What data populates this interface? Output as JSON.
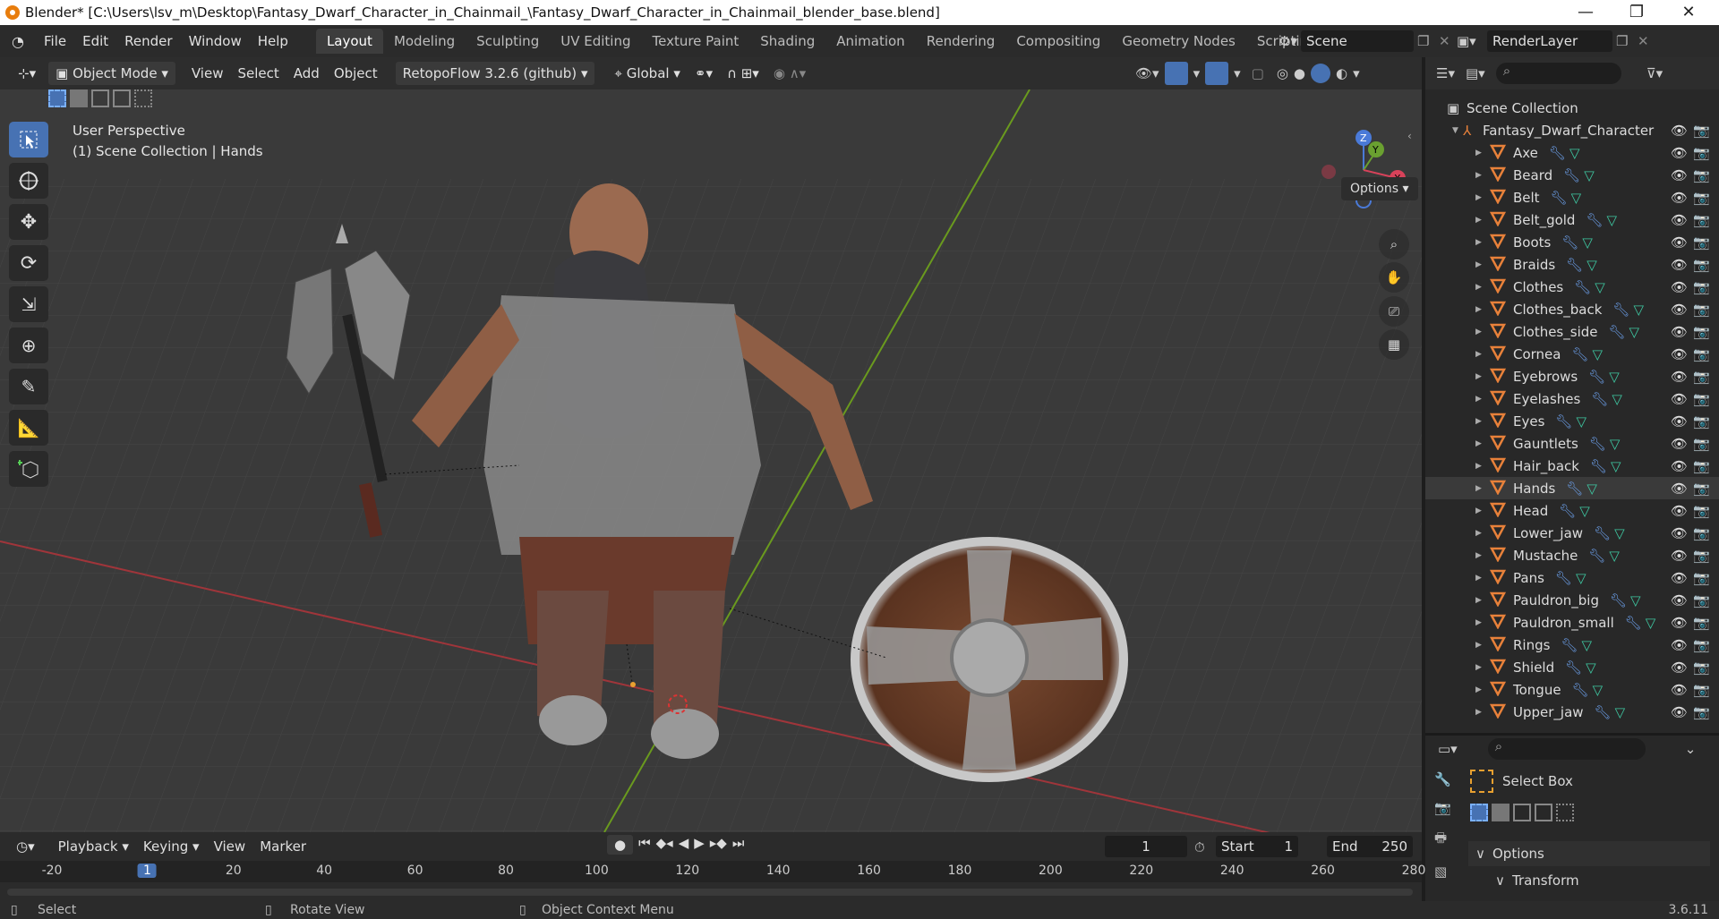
{
  "window": {
    "title": "Blender* [C:\\Users\\lsv_m\\Desktop\\Fantasy_Dwarf_Character_in_Chainmail_\\Fantasy_Dwarf_Character_in_Chainmail_blender_base.blend]",
    "minimize": "—",
    "maximize": "❐",
    "close": "✕"
  },
  "menu": [
    "File",
    "Edit",
    "Render",
    "Window",
    "Help"
  ],
  "workspaces": [
    "Layout",
    "Modeling",
    "Sculpting",
    "UV Editing",
    "Texture Paint",
    "Shading",
    "Animation",
    "Rendering",
    "Compositing",
    "Geometry Nodes",
    "Scripting",
    "+"
  ],
  "active_workspace": "Layout",
  "scene": {
    "name": "Scene",
    "render_layer": "RenderLayer"
  },
  "viewport_header": {
    "mode": "Object Mode",
    "menus": [
      "View",
      "Select",
      "Add",
      "Object"
    ],
    "addon": "RetopoFlow 3.2.6 (github)",
    "orientation": "Global",
    "options": "Options"
  },
  "viewport": {
    "perspective": "User Perspective",
    "context": "(1) Scene Collection | Hands",
    "gizmo": {
      "x": "X",
      "y": "Y",
      "z": "Z"
    }
  },
  "outliner": {
    "root": "Scene Collection",
    "collection": "Fantasy_Dwarf_Character",
    "items": [
      "Axe",
      "Beard",
      "Belt",
      "Belt_gold",
      "Boots",
      "Braids",
      "Clothes",
      "Clothes_back",
      "Clothes_side",
      "Cornea",
      "Eyebrows",
      "Eyelashes",
      "Eyes",
      "Gauntlets",
      "Hair_back",
      "Hands",
      "Head",
      "Lower_jaw",
      "Mustache",
      "Pans",
      "Pauldron_big",
      "Pauldron_small",
      "Rings",
      "Shield",
      "Tongue",
      "Upper_jaw"
    ],
    "selected": "Hands",
    "colors": {
      "mesh": "#e8813a",
      "modifier": "#6b9ee8",
      "data": "#3ec7a1",
      "selected_row": "#3a3a3a"
    }
  },
  "properties": {
    "tool": "Select Box",
    "options": "Options",
    "transform": "Transform"
  },
  "timeline": {
    "menus": [
      "Playback",
      "Keying",
      "View",
      "Marker"
    ],
    "current_frame": "1",
    "start_label": "Start",
    "start": "1",
    "end_label": "End",
    "end": "250",
    "ruler": [
      "-20",
      "1",
      "20",
      "40",
      "60",
      "80",
      "100",
      "120",
      "140",
      "160",
      "180",
      "200",
      "220",
      "240",
      "260",
      "280"
    ]
  },
  "statusbar": {
    "select": "Select",
    "rotate": "Rotate View",
    "context": "Object Context Menu",
    "version": "3.6.11"
  }
}
